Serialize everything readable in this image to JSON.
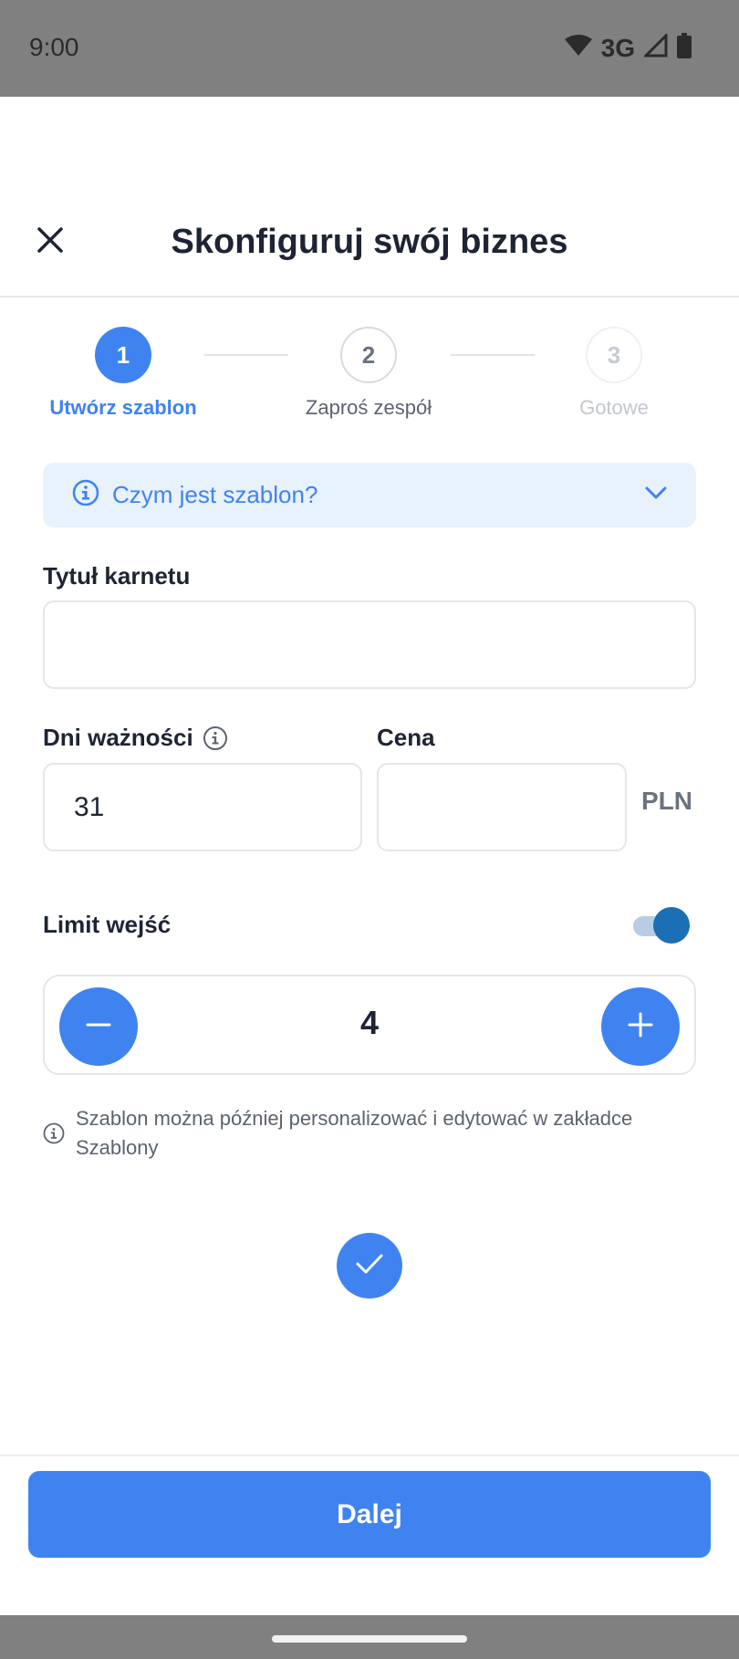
{
  "status_bar": {
    "time": "9:00",
    "network": "3G"
  },
  "header": {
    "title": "Skonfiguruj swój biznes"
  },
  "stepper": {
    "steps": [
      {
        "number": "1",
        "label": "Utwórz szablon"
      },
      {
        "number": "2",
        "label": "Zaproś zespół"
      },
      {
        "number": "3",
        "label": "Gotowe"
      }
    ]
  },
  "info_box": {
    "label": "Czym jest szablon?"
  },
  "form": {
    "title_label": "Tytuł karnetu",
    "title_value": "",
    "days_label": "Dni ważności",
    "days_value": "31",
    "price_label": "Cena",
    "price_value": "",
    "currency": "PLN",
    "limit_label": "Limit wejść",
    "limit_enabled": true,
    "limit_value": "4"
  },
  "hint": {
    "text": "Szablon można później personalizować i edytować w zakładce Szablony"
  },
  "footer": {
    "next_label": "Dalej"
  },
  "colors": {
    "accent": "#3f83f1",
    "toggle": "#1b6fb5",
    "info_bg": "#e8f2fd"
  }
}
